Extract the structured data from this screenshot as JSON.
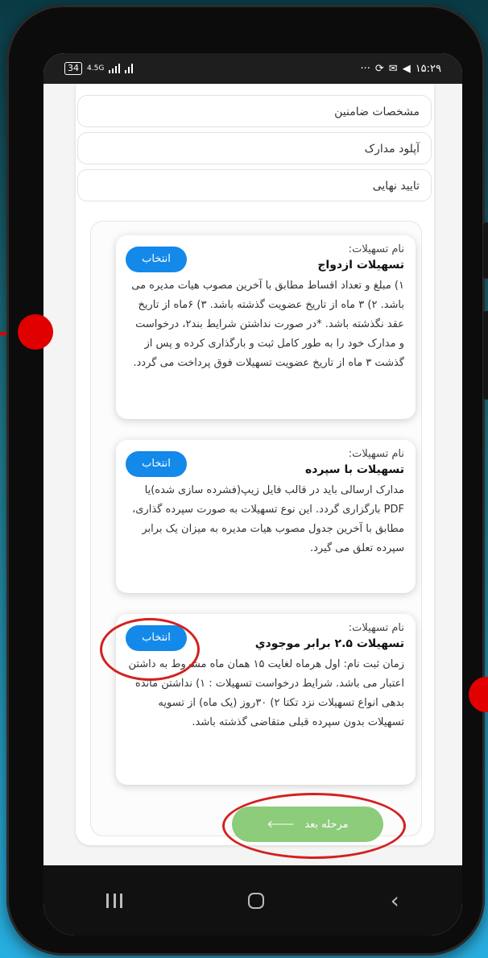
{
  "status_bar": {
    "battery": "34",
    "network": "4.5G",
    "time": "۱۵:۲۹"
  },
  "steps": [
    {
      "label": "مشخصات ضامنین"
    },
    {
      "label": "آپلود مدارک"
    },
    {
      "label": "تایید نهایی"
    }
  ],
  "loans": [
    {
      "label": "نام تسهیلات:",
      "name": "تسهیلات ازدواج",
      "select": "انتخاب",
      "description": "۱) مبلغ و تعداد اقساط مطابق با آخرین مصوب هیات مدیره می باشد. ۲) ۳ ماه از تاریخ عضویت گذشته باشد. ۳) ۶ماه از تاریخ عقد نگذشته باشد. *در صورت نداشتن شرایط بند۲، درخواست و مدارک خود را به طور کامل ثبت و بارگذاری کرده و پس از گذشت ۳ ماه از تاریخ عضویت تسهیلات فوق پرداخت می گردد."
    },
    {
      "label": "نام تسهیلات:",
      "name": "تسهیلات با سپرده",
      "select": "انتخاب",
      "description": "مدارک ارسالی باید در قالب فایل زیپ(فشرده سازی شده)یا PDF بارگزاری گردد. این نوع تسهیلات به صورت سپرده گذاری، مطابق با آخرین جدول مصوب هیات مدیره به میزان یک برابر سپرده تعلق می گیرد."
    },
    {
      "label": "نام تسهیلات:",
      "name": "تسهیلات ۲.۵ برابر موجودي",
      "select": "انتخاب",
      "description": "زمان ثبت نام: اول هرماه لغایت ۱۵ همان ماه مشروط به داشتن اعتبار می باشد. شرایط درخواست تسهیلات : ۱) نداشتن مانده بدهی انواع تسهیلات نزد تکتا ۲) ۳۰روز (یک ماه) از تسویه تسهیلات بدون سپرده قبلی متقاضی گذشته باشد."
    }
  ],
  "next_button": {
    "label": "مرحله بعد",
    "icon": "arrow-left-icon"
  },
  "colors": {
    "select_button": "#1389e9",
    "next_button": "#8ccc7a",
    "highlight_ring": "#d42020"
  }
}
